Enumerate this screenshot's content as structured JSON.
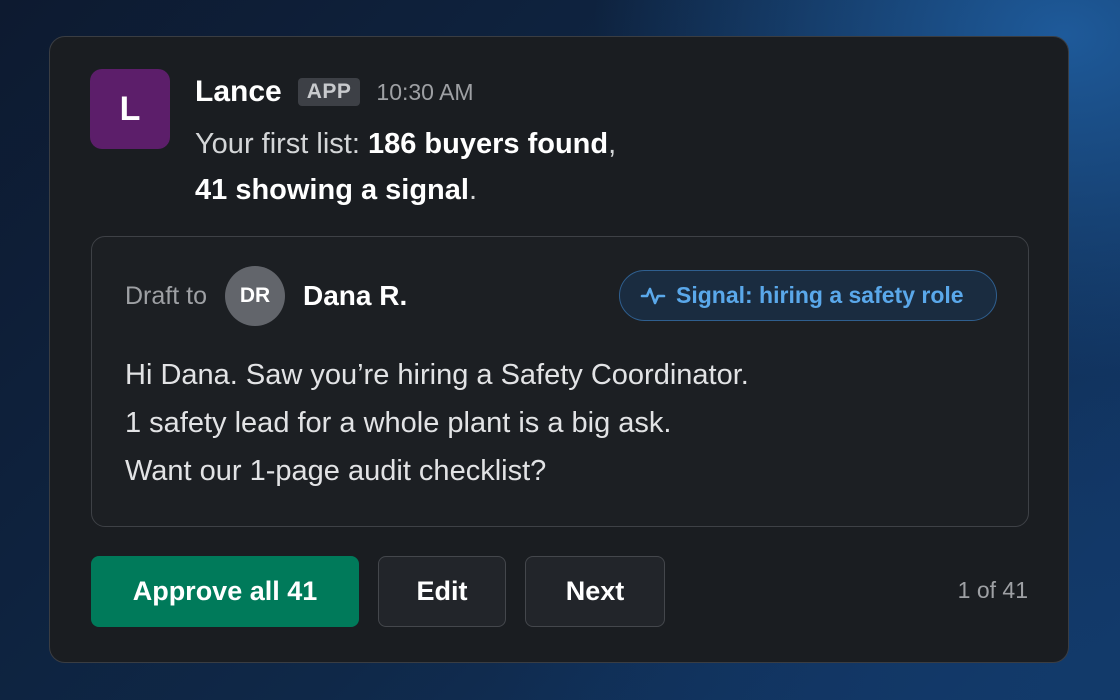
{
  "message": {
    "sender": "Lance",
    "avatar_letter": "L",
    "badge": "APP",
    "timestamp": "10:30 AM",
    "text": {
      "line1_prefix": "Your first list: ",
      "line1_bold": "186 buyers found",
      "line1_suffix": ",",
      "line2_bold": "41 showing a signal",
      "line2_suffix": "."
    }
  },
  "draft": {
    "label": "Draft to",
    "recipient_initials": "DR",
    "recipient_name": "Dana R.",
    "signal": {
      "icon": "activity-pulse-icon",
      "label": "Signal: hiring a safety role"
    },
    "body_lines": [
      "Hi Dana. Saw you’re hiring a Safety Coordinator.",
      "1 safety lead for a whole plant is a big ask.",
      "Want our 1-page audit checklist?"
    ]
  },
  "actions": {
    "approve_label": "Approve all 41",
    "edit_label": "Edit",
    "next_label": "Next"
  },
  "counter": "1 of 41",
  "colors": {
    "avatar": "#5c1e6a",
    "approve": "#007a5a",
    "signal": "#5aa8ea",
    "card": "#1a1d21"
  }
}
